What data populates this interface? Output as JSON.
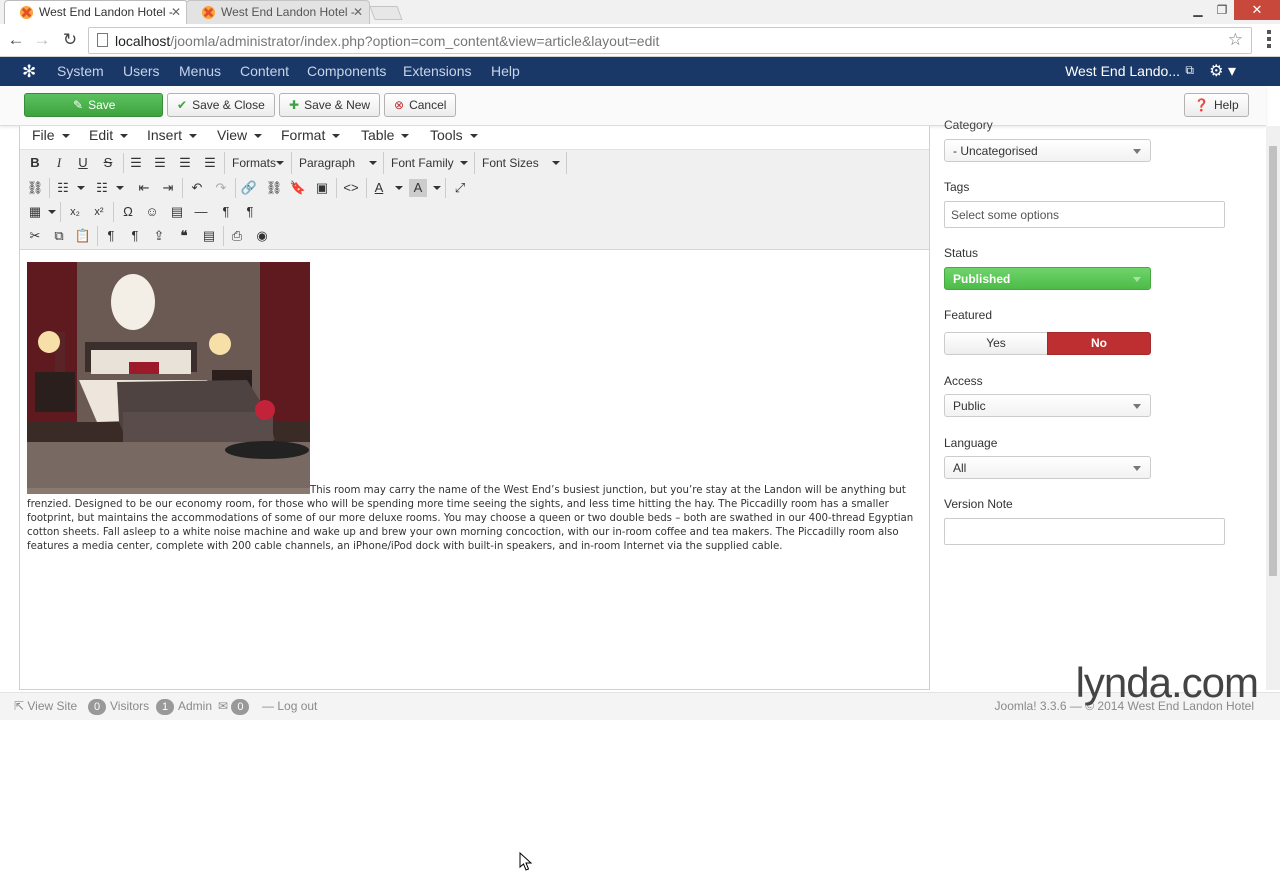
{
  "browser": {
    "tabs": [
      {
        "title": "West End Landon Hotel - ",
        "active": true
      },
      {
        "title": "West End Landon Hotel - ",
        "active": false
      }
    ],
    "url_host": "localhost",
    "url_path": "/joomla/administrator/index.php?option=com_content&view=article&layout=edit"
  },
  "admin_nav": {
    "items": [
      "System",
      "Users",
      "Menus",
      "Content",
      "Components",
      "Extensions",
      "Help"
    ],
    "site_name": "West End Lando..."
  },
  "toolbar": {
    "save": "Save",
    "save_close": "Save & Close",
    "save_new": "Save & New",
    "cancel": "Cancel",
    "help": "Help"
  },
  "editor": {
    "menus": [
      "File",
      "Edit",
      "Insert",
      "View",
      "Format",
      "Table",
      "Tools"
    ],
    "dropdowns": {
      "formats": "Formats",
      "paragraph": "Paragraph",
      "font_family": "Font Family",
      "font_sizes": "Font Sizes"
    },
    "article_text": "This room may carry the name of the West End’s busiest junction, but you’re stay at the Landon will be anything but frenzied. Designed to be our economy room, for those who will be spending more time seeing the sights, and less time hitting the hay. The Piccadilly room has a smaller footprint, but maintains the accommodations of some of our more deluxe rooms. You may choose a queen or two double beds – both are swathed in our 400-thread Egyptian cotton sheets. Fall asleep to a white noise machine and wake up and brew your own morning concoction, with our in-room coffee and tea makers. The Piccadilly room also features a media center, complete with 200 cable channels, an iPhone/iPod dock with built-in speakers, and in-room Internet via the supplied cable."
  },
  "sidebar": {
    "category_label": "Category",
    "category_value": "- Uncategorised",
    "tags_label": "Tags",
    "tags_placeholder": "Select some options",
    "status_label": "Status",
    "status_value": "Published",
    "featured_label": "Featured",
    "featured_yes": "Yes",
    "featured_no": "No",
    "access_label": "Access",
    "access_value": "Public",
    "language_label": "Language",
    "language_value": "All",
    "version_note_label": "Version Note",
    "version_note_value": ""
  },
  "statusbar": {
    "view_site": "View Site",
    "visitors_count": "0",
    "visitors_label": "Visitors",
    "admin_count": "1",
    "admin_label": "Admin",
    "messages_count": "0",
    "logout": "Log out",
    "footer": "Joomla! 3.3.6 — © 2014 West End Landon Hotel"
  },
  "watermark": "lynda.com",
  "colors": {
    "nav_bg": "#1a3867",
    "save_green": "#4cae4c",
    "published_green": "#5ac856",
    "featured_no_red": "#bd2f30"
  }
}
